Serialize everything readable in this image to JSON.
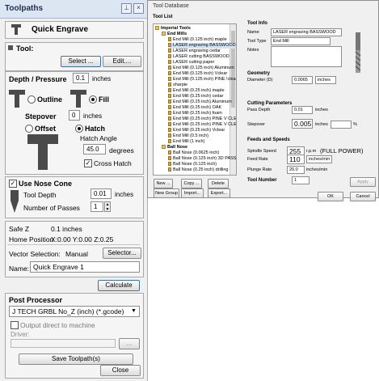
{
  "toolpaths": {
    "title": "Toolpaths",
    "header": "Quick Engrave",
    "tool_label": "Tool:",
    "select_btn": "Select ...",
    "edit_btn": "Edit....",
    "depth_label": "Depth / Pressure",
    "depth_value": "0.1",
    "depth_unit": "inches",
    "outline_label": "Outline",
    "fill_label": "Fill",
    "stepover_label": "Stepover",
    "stepover_value": "0",
    "stepover_unit": "inches",
    "offset_label": "Offset",
    "hatch_label": "Hatch",
    "hatch_angle_label": "Hatch Angle",
    "hatch_angle_value": "45.0",
    "hatch_angle_unit": "degrees",
    "cross_hatch_label": "Cross Hatch",
    "nose_cone_label": "Use Nose Cone",
    "tool_depth_label": "Tool Depth",
    "tool_depth_value": "0.01",
    "tool_depth_unit": "inches",
    "passes_label": "Number of Passes",
    "passes_value": "1",
    "safe_z_label": "Safe Z",
    "safe_z_value": "0.1 inches",
    "home_label": "Home Position",
    "home_value": "X:0.00 Y:0.00 Z:0.25",
    "vector_sel_label": "Vector Selection:",
    "vector_sel_value": "Manual",
    "selector_btn": "Selector...",
    "name_label": "Name:",
    "name_value": "Quick Engrave 1",
    "calculate_btn": "Calculate",
    "post_label": "Post Processor",
    "post_value": "J TECH GRBL No_Z (inch) (*.gcode)",
    "output_direct_label": "Output direct to machine",
    "driver_label": "Driver:",
    "driver_btn": "...",
    "save_btn": "Save Toolpath(s)",
    "close_btn": "Close"
  },
  "tool_database": {
    "title": "Tool Database",
    "list_header": "Tool List",
    "tree": [
      {
        "label": "Imperial Tools",
        "level": 0,
        "type": "folder"
      },
      {
        "label": "End Mills",
        "level": 1,
        "type": "folder"
      },
      {
        "label": "End Mill (0.125 inch) maple",
        "level": 2,
        "type": "bit"
      },
      {
        "label": "LASER engraving BASSWOOD",
        "level": 2,
        "type": "bit"
      },
      {
        "label": "LASER engraving cedar",
        "level": 2,
        "type": "bit"
      },
      {
        "label": "LASER cutting BASSWOOD",
        "level": 2,
        "type": "bit"
      },
      {
        "label": "LASER cutting paper",
        "level": 2,
        "type": "bit"
      },
      {
        "label": "End Mill (0.125 inch) Aluminum",
        "level": 2,
        "type": "bit"
      },
      {
        "label": "End Mill (0.125 inch) Vclear",
        "level": 2,
        "type": "bit"
      },
      {
        "label": "End Mill (0.125 inch) PINE !clear",
        "level": 2,
        "type": "bit"
      },
      {
        "label": "sharpie",
        "level": 2,
        "type": "bit"
      },
      {
        "label": "End Mill (0.25 inch) maple",
        "level": 2,
        "type": "bit"
      },
      {
        "label": "End Mill (0.25 inch) cedar",
        "level": 2,
        "type": "bit"
      },
      {
        "label": "End Mill (0.25 inch) Aluminum",
        "level": 2,
        "type": "bit"
      },
      {
        "label": "End Mill (0.25 inch) OAK",
        "level": 2,
        "type": "bit"
      },
      {
        "label": "End Mill (0.25 inch) foam",
        "level": 2,
        "type": "bit"
      },
      {
        "label": "End Mill (0.25 inch) PINE V CLEAR",
        "level": 2,
        "type": "bit"
      },
      {
        "label": "End Mill (0.25 inch) PINE V CLEAR",
        "level": 2,
        "type": "bit"
      },
      {
        "label": "End Mill (0.25 inch) Vclear",
        "level": 2,
        "type": "bit"
      },
      {
        "label": "End Mill (0.5 inch)",
        "level": 2,
        "type": "bit"
      },
      {
        "label": "End Mill (1 inch)",
        "level": 2,
        "type": "bit"
      },
      {
        "label": "Ball Nose",
        "level": 1,
        "type": "folder"
      },
      {
        "label": "Ball Nose (0.0625 inch)",
        "level": 2,
        "type": "bit"
      },
      {
        "label": "Ball Nose (0.125 inch) 3D PASS",
        "level": 2,
        "type": "bit"
      },
      {
        "label": "Ball Nose (0.125 inch)",
        "level": 2,
        "type": "bit"
      },
      {
        "label": "Ball Nose (0.25 inch) drilling",
        "level": 2,
        "type": "bit"
      }
    ],
    "new_btn": "New ...",
    "copy_btn": "Copy ...",
    "delete_btn": "Delete",
    "new_group_btn": "New Group",
    "import_btn": "Import...",
    "export_btn": "Export...",
    "tool_info_header": "Tool Info",
    "name_label": "Name",
    "name_value": "LASER engraving BASSWOOD",
    "tool_type_label": "Tool Type",
    "tool_type_value": "End Mill",
    "notes_label": "Notes",
    "geometry_header": "Geometry",
    "diameter_label": "Diameter (D)",
    "diameter_value": "0.0065",
    "diameter_unit": "inches",
    "cutting_header": "Cutting Parameters",
    "pass_depth_label": "Pass Depth",
    "pass_depth_value": "0.01",
    "pass_depth_unit": "inches",
    "stepover_label": "Stepover",
    "stepover_value": "0.005",
    "stepover_unit": "inches",
    "stepover_pct_unit": "%",
    "feeds_header": "Feeds and Speeds",
    "spindle_label": "Spindle Speed",
    "spindle_value": "255",
    "spindle_unit": "r.p.m",
    "spindle_note": "(FULL POWER)",
    "feed_label": "Feed Rate",
    "feed_value": "110",
    "feed_unit": "inches/min",
    "plunge_label": "Plunge Rate",
    "plunge_value": "20.0",
    "plunge_unit": "inches/min",
    "tool_number_label": "Tool Number",
    "tool_number_value": "1",
    "apply_btn": "Apply",
    "ok_btn": "OK",
    "cancel_btn": "Cancel"
  },
  "colors": {
    "title_bg": "#dce6f2",
    "tool_bit": "#d9a441",
    "T_icon": "#4a4a4a"
  }
}
